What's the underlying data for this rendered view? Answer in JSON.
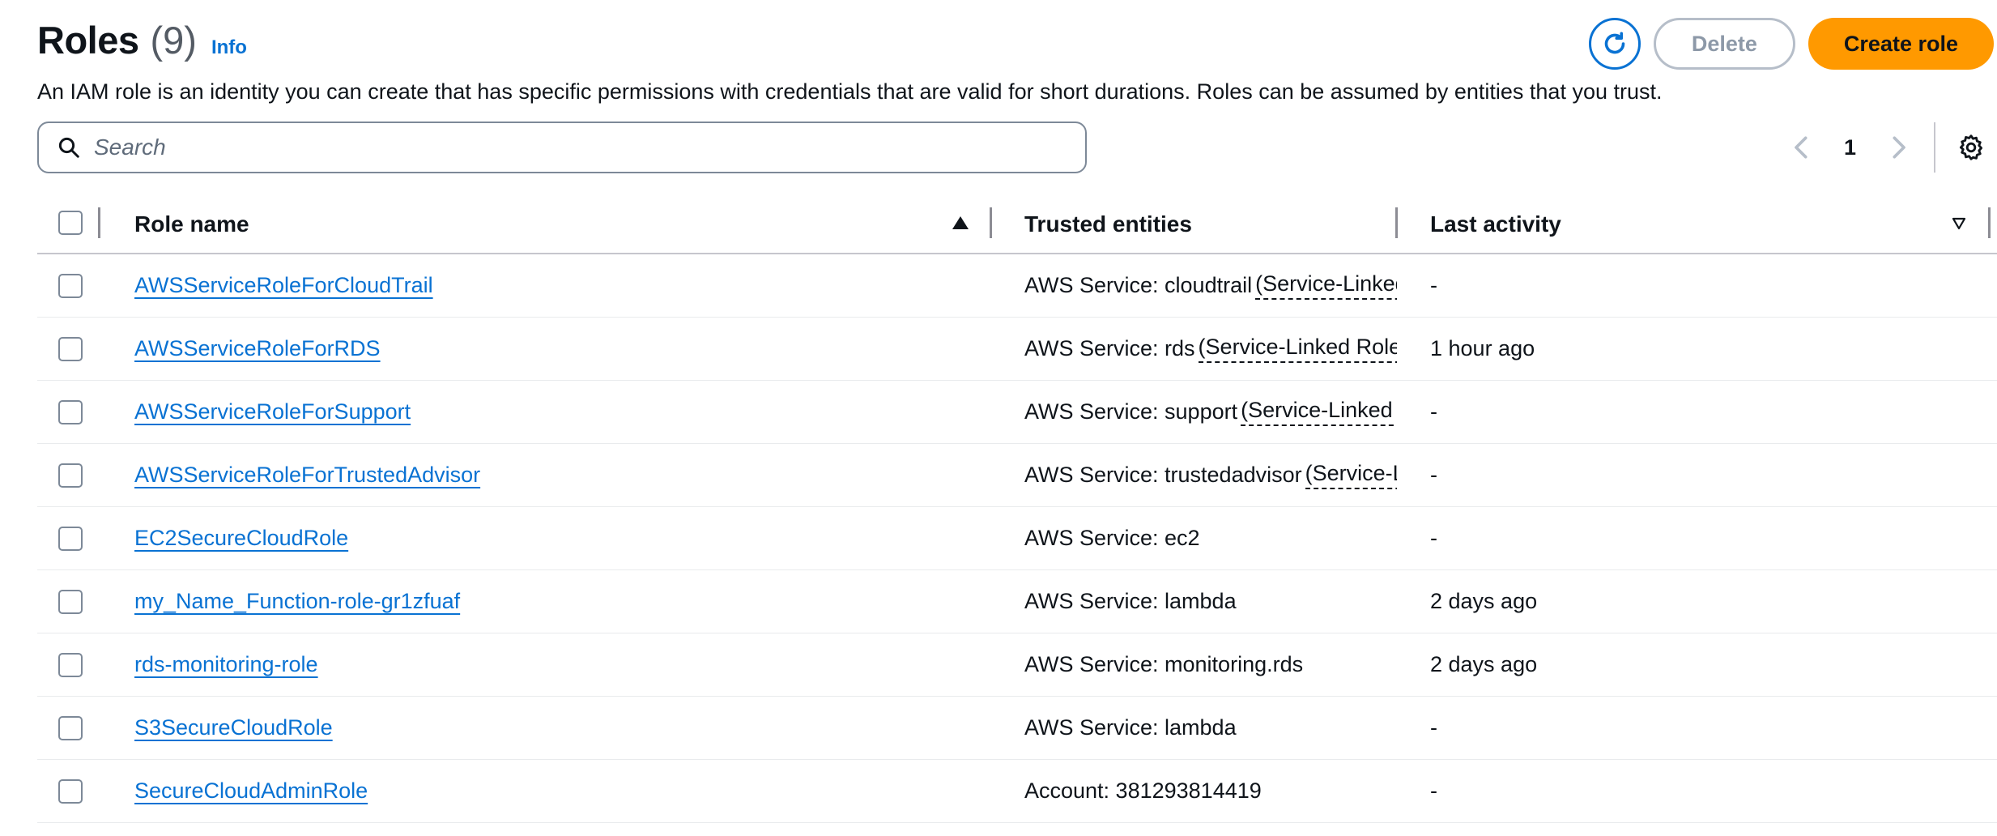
{
  "header": {
    "title": "Roles",
    "count": "(9)",
    "info": "Info",
    "description": "An IAM role is an identity you can create that has specific permissions with credentials that are valid for short durations. Roles can be assumed by entities that you trust."
  },
  "actions": {
    "refresh_icon": "refresh-icon",
    "delete_label": "Delete",
    "create_label": "Create role"
  },
  "search": {
    "placeholder": "Search",
    "value": ""
  },
  "pagination": {
    "current_page": "1"
  },
  "table": {
    "columns": {
      "role_name": "Role name",
      "trusted_entities": "Trusted entities",
      "last_activity": "Last activity"
    },
    "rows": [
      {
        "name": "AWSServiceRoleForCloudTrail",
        "trusted_prefix": "AWS Service: cloudtrail",
        "trusted_linked": "(Service-Linked Role)",
        "last": "-"
      },
      {
        "name": "AWSServiceRoleForRDS",
        "trusted_prefix": "AWS Service: rds",
        "trusted_linked": "(Service-Linked Role)",
        "last": "1 hour ago"
      },
      {
        "name": "AWSServiceRoleForSupport",
        "trusted_prefix": "AWS Service: support",
        "trusted_linked": "(Service-Linked Role)",
        "last": "-"
      },
      {
        "name": "AWSServiceRoleForTrustedAdvisor",
        "trusted_prefix": "AWS Service: trustedadvisor",
        "trusted_linked": "(Service-Linked Role)",
        "last": "-"
      },
      {
        "name": "EC2SecureCloudRole",
        "trusted_prefix": "AWS Service: ec2",
        "trusted_linked": "",
        "last": "-"
      },
      {
        "name": "my_Name_Function-role-gr1zfuaf",
        "trusted_prefix": "AWS Service: lambda",
        "trusted_linked": "",
        "last": "2 days ago"
      },
      {
        "name": "rds-monitoring-role",
        "trusted_prefix": "AWS Service: monitoring.rds",
        "trusted_linked": "",
        "last": "2 days ago"
      },
      {
        "name": "S3SecureCloudRole",
        "trusted_prefix": "AWS Service: lambda",
        "trusted_linked": "",
        "last": "-"
      },
      {
        "name": "SecureCloudAdminRole",
        "trusted_prefix": "Account: 381293814419",
        "trusted_linked": "",
        "last": "-"
      }
    ]
  },
  "colors": {
    "link": "#0972d3",
    "primary_button": "#ff9900",
    "disabled_text": "#8d99a8"
  }
}
